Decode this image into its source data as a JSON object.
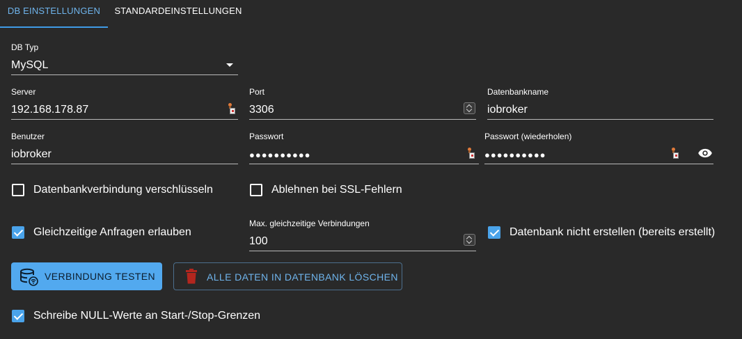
{
  "tabs": [
    {
      "label": "DB Einstellungen",
      "active": true
    },
    {
      "label": "Standardeinstellungen",
      "active": false
    }
  ],
  "fields": {
    "db_type": {
      "label": "DB Typ",
      "value": "MySQL"
    },
    "server": {
      "label": "Server",
      "value": "192.168.178.87"
    },
    "port": {
      "label": "Port",
      "value": "3306"
    },
    "db_name": {
      "label": "Datenbankname",
      "value": "iobroker"
    },
    "user": {
      "label": "Benutzer",
      "value": "iobroker"
    },
    "password": {
      "label": "Passwort",
      "value": "●●●●●●●●●●"
    },
    "password_repeat": {
      "label": "Passwort (wiederholen)",
      "value": "●●●●●●●●●●"
    },
    "max_connections": {
      "label": "Max. gleichzeitige Verbindungen",
      "value": "100"
    }
  },
  "checkboxes": {
    "encrypt": {
      "label": "Datenbankverbindung verschlüsseln",
      "checked": false
    },
    "reject_ssl": {
      "label": "Ablehnen bei SSL-Fehlern",
      "checked": false
    },
    "parallel": {
      "label": "Gleichzeitige Anfragen erlauben",
      "checked": true
    },
    "no_create": {
      "label": "Datenbank nicht erstellen (bereits erstellt)",
      "checked": true
    },
    "null_values": {
      "label": "Schreibe NULL-Werte an Start-/Stop-Grenzen",
      "checked": true
    }
  },
  "buttons": {
    "test_connection": "Verbindung testen",
    "delete_all": "Alle Daten in Datenbank löschen"
  },
  "icons": {
    "database_wifi": "database-wifi-icon",
    "delete": "trash-icon",
    "eye": "eye-icon",
    "autofill": "password-manager-icon"
  },
  "colors": {
    "background": "#292929",
    "accent": "#52a9ef",
    "tab_active": "#6fb4ec",
    "delete_icon": "#b3261e"
  }
}
